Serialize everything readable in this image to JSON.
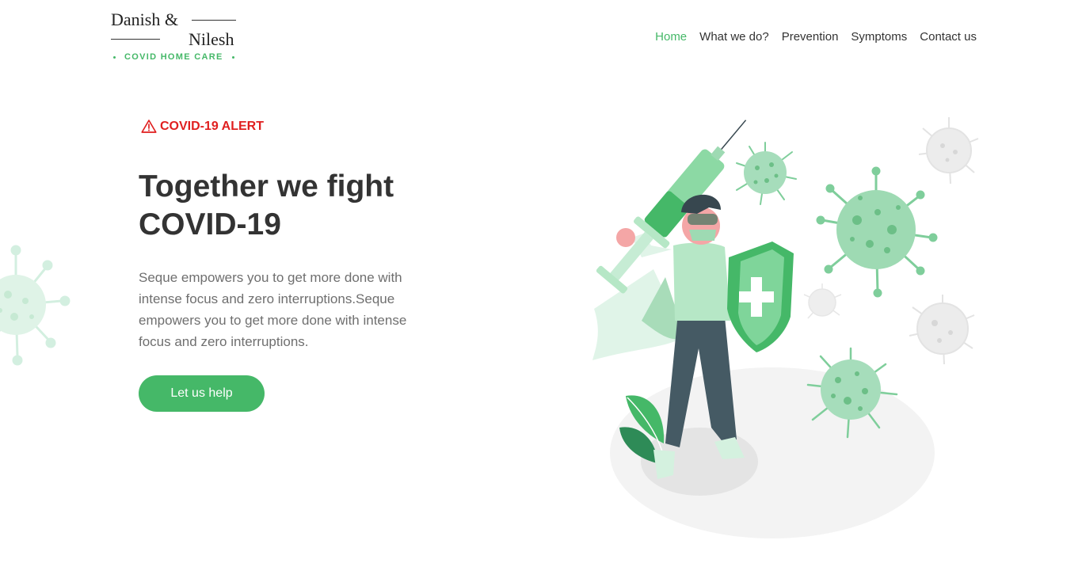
{
  "logo": {
    "line1": "Danish &",
    "line2": "Nilesh",
    "tagline": "COVID HOME CARE"
  },
  "nav": {
    "items": [
      {
        "label": "Home",
        "active": true
      },
      {
        "label": "What we do?",
        "active": false
      },
      {
        "label": "Prevention",
        "active": false
      },
      {
        "label": "Symptoms",
        "active": false
      },
      {
        "label": "Contact us",
        "active": false
      }
    ]
  },
  "hero": {
    "alert_icon": "warning-triangle-icon",
    "alert": "COVID-19 ALERT",
    "title_line1": "Together we fight",
    "title_line2": "COVID-19",
    "description": "Seque empowers you to get more done with intense focus and zero interruptions.Seque empowers you to get more done with intense focus and zero interruptions.",
    "cta": "Let us help"
  },
  "colors": {
    "accent": "#45b868",
    "alert": "#e01f1f",
    "heading": "#333333",
    "body_text": "#6f6f6f"
  }
}
